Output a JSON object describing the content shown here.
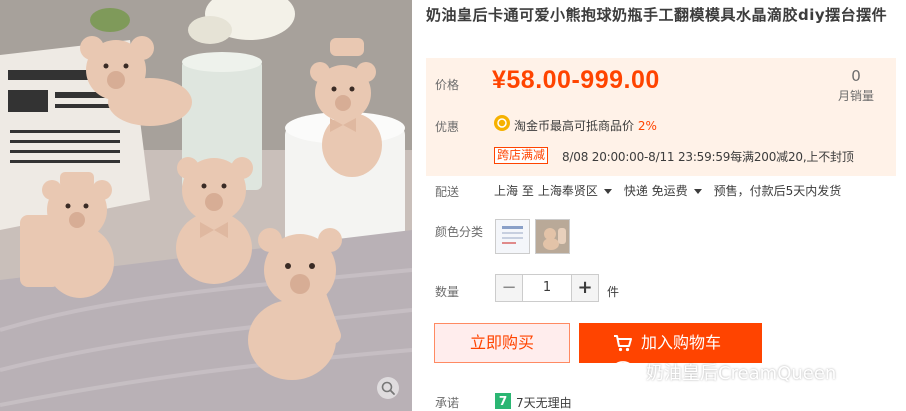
{
  "product": {
    "title": "奶油皇后卡通可爱小熊抱球奶瓶手工翻模模具水晶滴胶diy摆台摆件",
    "image_icon": "bear-figurines-photo",
    "zoom_icon": "magnifier-icon"
  },
  "price": {
    "label": "价格",
    "value": "¥58.00-999.00",
    "sales_count": "0",
    "sales_label": "月销量"
  },
  "promotion": {
    "label": "优惠",
    "coin_text": "淘金币最高可抵商品价",
    "coin_rate": "2%",
    "shop_tag": "跨店满减",
    "shop_promo": "8/08 20:00:00-8/11 23:59:59每满200减20,上不封顶"
  },
  "shipping": {
    "label": "配送",
    "from": "上海 至",
    "to": "上海奉贤区",
    "method": "快递 免运费",
    "note": "预售，付款后5天内发货"
  },
  "color": {
    "label": "颜色分类"
  },
  "quantity": {
    "label": "数量",
    "minus": "−",
    "value": "1",
    "plus": "+",
    "unit": "件"
  },
  "actions": {
    "buy_now": "立即购买",
    "add_to_cart": "加入购物车"
  },
  "promise": {
    "label": "承诺",
    "icon_text": "7",
    "text": "7天无理由"
  },
  "watermark": {
    "text": "奶油皇后CreamQueen"
  },
  "colors": {
    "accent": "#ff4400",
    "price_bg": "#fff2e8",
    "buy_bg": "#ffeded",
    "promise_green": "#2bb673"
  }
}
